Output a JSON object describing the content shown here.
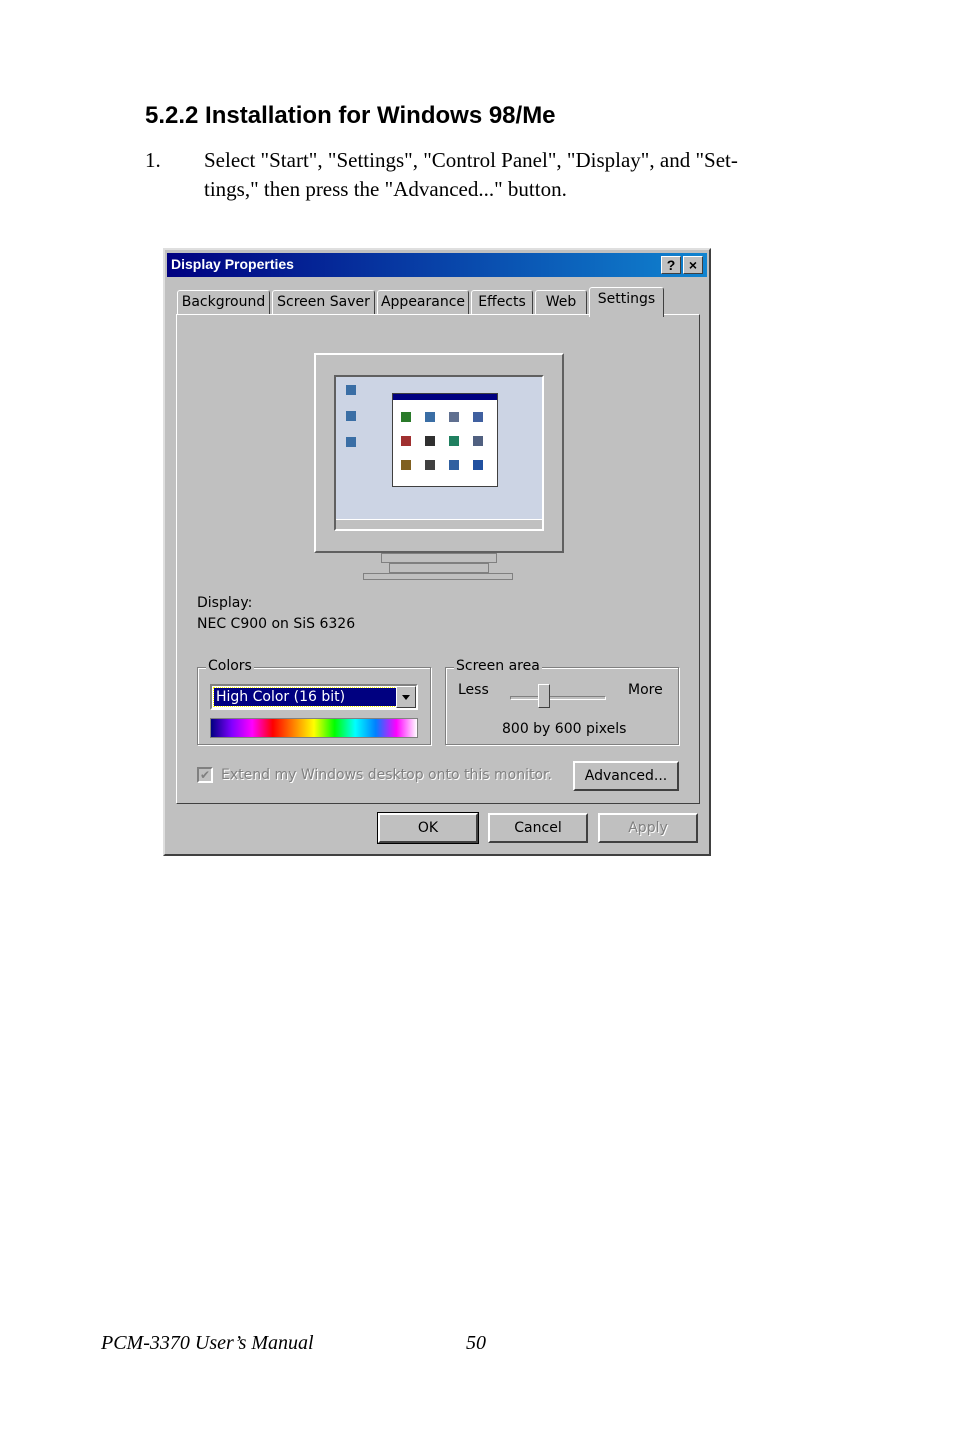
{
  "heading": "5.2.2 Installation for Windows 98/Me",
  "step": {
    "number": "1.",
    "line1": "Select \"Start\", \"Settings\", \"Control Panel\", \"Display\", and \"Set-",
    "line2": "tings,\" then press the \"Advanced...\" button."
  },
  "dialog": {
    "title": "Display Properties",
    "help_label": "?",
    "close_label": "×",
    "tabs": [
      "Background",
      "Screen Saver",
      "Appearance",
      "Effects",
      "Web",
      "Settings"
    ],
    "active_tab": "Settings",
    "display_label": "Display:",
    "display_value": "NEC C900 on SiS 6326",
    "colors_label": "Colors",
    "colors_value": "High Color (16 bit)",
    "screen_area_label": "Screen area",
    "less_label": "Less",
    "more_label": "More",
    "resolution": "800 by 600 pixels",
    "extend_label": "Extend my Windows desktop onto this monitor.",
    "advanced_button": "Advanced...",
    "ok_button": "OK",
    "cancel_button": "Cancel",
    "apply_button": "Apply"
  },
  "footer": {
    "manual": "PCM-3370 User’s Manual",
    "page": "50"
  }
}
